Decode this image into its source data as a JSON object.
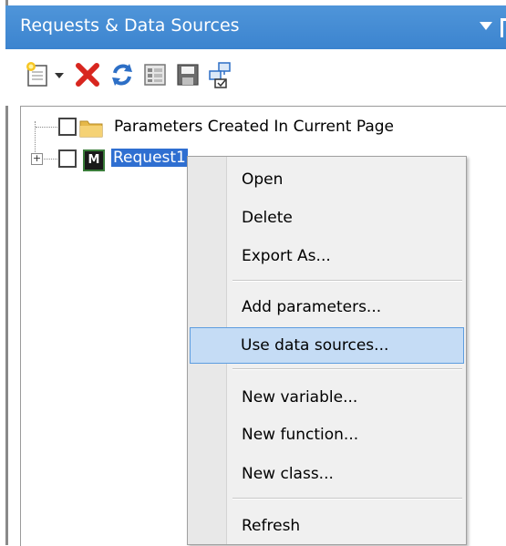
{
  "panel": {
    "title": "Requests & Data Sources"
  },
  "toolbar": {
    "buttons": [
      {
        "icon": "new-request-icon"
      },
      {
        "icon": "dropdown-arrow-icon"
      },
      {
        "icon": "delete-icon"
      },
      {
        "icon": "refresh-icon"
      },
      {
        "icon": "properties-icon"
      },
      {
        "icon": "save-icon"
      },
      {
        "icon": "structure-icon"
      }
    ]
  },
  "tree": {
    "items": [
      {
        "label": "Parameters Created In Current Page",
        "icon": "folder-icon",
        "selected": false
      },
      {
        "label": "Request1",
        "icon": "m-icon",
        "icon_text": "M",
        "selected": true
      }
    ]
  },
  "context_menu": {
    "items": [
      {
        "label": "Open"
      },
      {
        "label": "Delete"
      },
      {
        "label": "Export As..."
      },
      {
        "label": "Add parameters..."
      },
      {
        "label": "Use data sources..."
      },
      {
        "label": "New variable..."
      },
      {
        "label": "New function..."
      },
      {
        "label": "New class..."
      },
      {
        "label": "Refresh"
      }
    ],
    "highlighted_item": "Use data sources..."
  },
  "colors": {
    "titlebar": "#4f95d9",
    "selection": "#2f6fd1",
    "menu_highlight": "#c5dcf5",
    "menu_highlight_border": "#5d9de0"
  }
}
